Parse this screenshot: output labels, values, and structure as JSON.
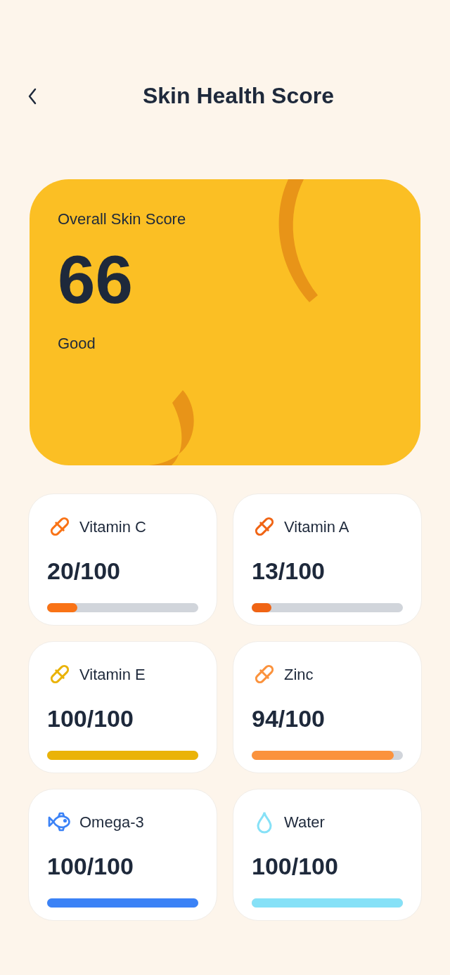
{
  "header": {
    "title": "Skin Health Score"
  },
  "overall": {
    "label": "Overall Skin Score",
    "score": "66",
    "rating": "Good"
  },
  "nutrients": [
    {
      "name": "Vitamin C",
      "kind": "pill",
      "color": "#f97316",
      "reading": "20/100",
      "level": 0.2
    },
    {
      "name": "Vitamin A",
      "kind": "pill",
      "color": "#f06414",
      "reading": "13/100",
      "level": 0.13
    },
    {
      "name": "Vitamin E",
      "kind": "pill",
      "color": "#eab308",
      "reading": "100/100",
      "level": 1
    },
    {
      "name": "Zinc",
      "kind": "pill",
      "color": "#fb923c",
      "reading": "94/100",
      "level": 0.94
    },
    {
      "name": "Omega-3",
      "kind": "fish",
      "color": "#3b82f6",
      "reading": "100/100",
      "level": 1
    },
    {
      "name": "Water",
      "kind": "drop",
      "color": "#86e1f7",
      "reading": "100/100",
      "level": 1
    }
  ]
}
